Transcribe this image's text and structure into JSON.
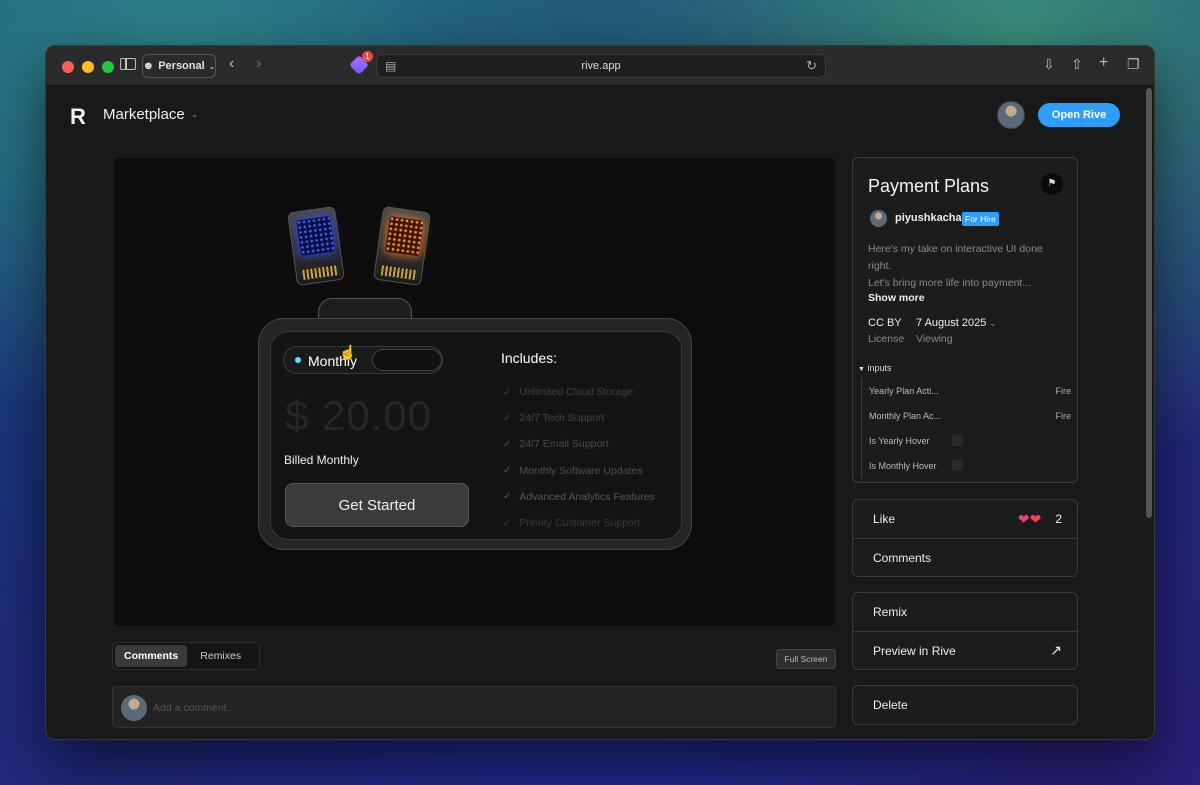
{
  "browser": {
    "profile_label": "Personal",
    "url": "rive.app",
    "extension_badge": "1"
  },
  "header": {
    "logo": "R",
    "brand": "Marketplace",
    "open_rive_label": "Open Rive"
  },
  "pricing_card": {
    "toggle_label": "Monthly",
    "price": "$ 20.00",
    "billed": "Billed Monthly",
    "cta_label": "Get Started",
    "includes_title": "Includes:",
    "features": [
      "Unlimited Cloud Storage",
      "24/7 Tech Support",
      "24/7 Email Support",
      "Monthly Software Updates",
      "Advanced Analytics Features",
      "Priority Customer Support"
    ],
    "feature_colors": [
      "#3f3f3f",
      "#444444",
      "#4a4a4a",
      "#505050",
      "#575757",
      "#3a3a3a"
    ],
    "accent": "#5be0ff"
  },
  "info_panel": {
    "title": "Payment Plans",
    "author": "piyushkacha",
    "badge": "For Hire",
    "description_line1": "Here's my take on interactive UI done right.",
    "description_line2": "Let's bring more life into payment...",
    "show_more": "Show more",
    "license_value": "CC BY",
    "license_label": "License",
    "date_value": "7 August 2025",
    "date_label": "Viewing",
    "inputs_heading": "inputs",
    "inputs": [
      {
        "name": "Yearly Plan Acti...",
        "value": "Fire"
      },
      {
        "name": "Monthly Plan Ac...",
        "value": "Fire"
      },
      {
        "name": "Is Yearly Hover",
        "value": ""
      },
      {
        "name": "Is Monthly Hover",
        "value": ""
      }
    ]
  },
  "actions": {
    "like_label": "Like",
    "like_count": "2",
    "comments_label": "Comments",
    "remix_label": "Remix",
    "preview_label": "Preview in Rive",
    "delete_label": "Delete"
  },
  "bottom": {
    "tabs": [
      "Comments",
      "Remixes"
    ],
    "fullscreen_label": "Full Screen",
    "comment_placeholder": "Add a comment..."
  }
}
